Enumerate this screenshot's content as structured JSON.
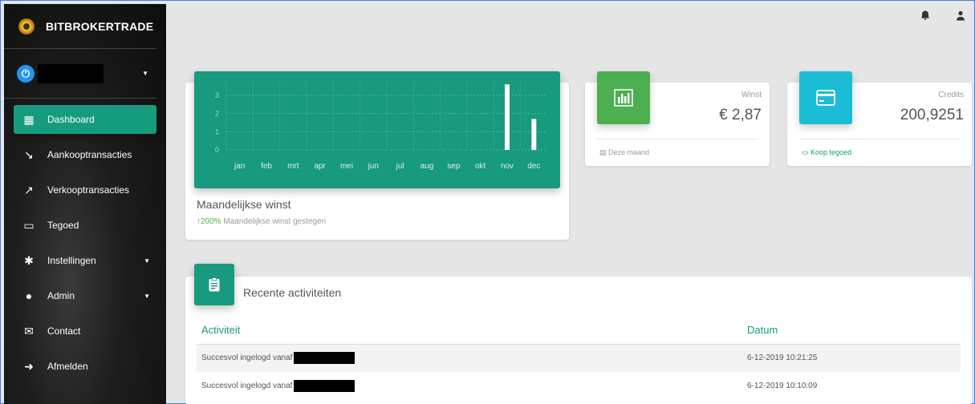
{
  "brand": {
    "name": "BITBROKERTRADE"
  },
  "user": {
    "avatar_glyph": "⏻"
  },
  "menu": [
    {
      "label": "Dashboard",
      "icon": "dashboard-icon",
      "glyph": "▦",
      "active": true,
      "caret": false
    },
    {
      "label": "Aankooptransacties",
      "icon": "trending-down-icon",
      "glyph": "↘",
      "active": false,
      "caret": false
    },
    {
      "label": "Verkooptransacties",
      "icon": "trending-up-icon",
      "glyph": "↗",
      "active": false,
      "caret": false
    },
    {
      "label": "Tegoed",
      "icon": "credit-card-icon",
      "glyph": "▭",
      "active": false,
      "caret": false
    },
    {
      "label": "Instellingen",
      "icon": "gear-icon",
      "glyph": "✱",
      "active": false,
      "caret": true
    },
    {
      "label": "Admin",
      "icon": "person-icon",
      "glyph": "●",
      "active": false,
      "caret": true
    },
    {
      "label": "Contact",
      "icon": "mail-icon",
      "glyph": "✉",
      "active": false,
      "caret": false
    },
    {
      "label": "Afmelden",
      "icon": "logout-icon",
      "glyph": "➜",
      "active": false,
      "caret": false
    }
  ],
  "topbar": {
    "notification_icon": "bell-icon",
    "account_icon": "person-icon"
  },
  "chart_card": {
    "title": "Maandelijkse winst",
    "growth_value": "200%",
    "growth_text": "Maandelijkse winst gestegen"
  },
  "chart_data": {
    "type": "bar",
    "categories": [
      "jan",
      "feb",
      "mrt",
      "apr",
      "mei",
      "jun",
      "jul",
      "aug",
      "sep",
      "okt",
      "nov",
      "dec"
    ],
    "values": [
      0,
      0,
      0,
      0,
      0,
      0,
      0,
      0,
      0,
      0,
      3.6,
      1.7
    ],
    "yticks": [
      0,
      1,
      2,
      3
    ],
    "ylim": [
      0,
      3.7
    ],
    "grid": true,
    "background": "#179a7e",
    "bar_color": "#ffffff"
  },
  "winst": {
    "label": "Winst",
    "value": "€ 2,87",
    "footer": "Deze maand",
    "icon": "bar-chart-icon"
  },
  "credits": {
    "label": "Credits",
    "value": "200,9251",
    "footer": "Koop tegoed",
    "icon": "credit-card-icon"
  },
  "activities": {
    "title": "Recente activiteiten",
    "headers": [
      "Activiteit",
      "Datum"
    ],
    "rows": [
      {
        "activity": "Succesvol ingelogd vanaf",
        "date": "6-12-2019 10:21:25"
      },
      {
        "activity": "Succesvol ingelogd vanaf",
        "date": "6-12-2019 10:10:09"
      }
    ]
  },
  "colors": {
    "accent": "#179a7e",
    "green": "#4caf50",
    "cyan": "#1bbcd6"
  }
}
